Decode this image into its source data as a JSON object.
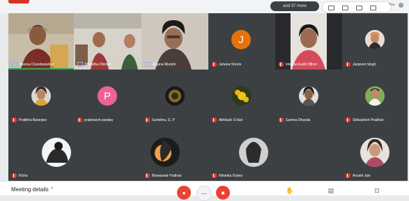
{
  "topbar": {
    "participants_pill": "and 37 more",
    "you_label": "You"
  },
  "tiles": [
    {
      "name": "Meena Chandawarkar",
      "type": "video",
      "speaking": true
    },
    {
      "name": "Moraltha Dhiman",
      "type": "video"
    },
    {
      "name": "Anjana Munshi",
      "type": "video"
    },
    {
      "name": "Juhana Shorts",
      "type": "letter",
      "letter": "J",
      "color": "#e8710a"
    },
    {
      "name": "Internal Audit Officer",
      "type": "video"
    },
    {
      "name": "Jaspreet Singh",
      "type": "photo"
    },
    {
      "name": "Pratibha Banerjee",
      "type": "photo"
    },
    {
      "name": "prabhansh pandey",
      "type": "letter",
      "letter": "P",
      "color": "#f06292"
    },
    {
      "name": "Sumithra, G. P",
      "type": "photo"
    },
    {
      "name": "Abhilash S Nair",
      "type": "photo"
    },
    {
      "name": "Garima Dhanda",
      "type": "photo"
    },
    {
      "name": "Shibashish Pradhan",
      "type": "photo"
    },
    {
      "name": "Richa",
      "type": "photo"
    },
    {
      "name": "Biswaswar Padhan",
      "type": "photo"
    },
    {
      "name": "Niharika Dubey",
      "type": "photo"
    },
    {
      "name": "Anushi Jain",
      "type": "photo"
    }
  ],
  "bottombar": {
    "meeting_details": "Meeting details",
    "chevron": "^"
  },
  "controls": {
    "mic_icon": "mic-off-icon",
    "camera_icon": "camera-off-icon",
    "hangup_icon": "call-end-icon",
    "accent_red": "#ea4335"
  }
}
